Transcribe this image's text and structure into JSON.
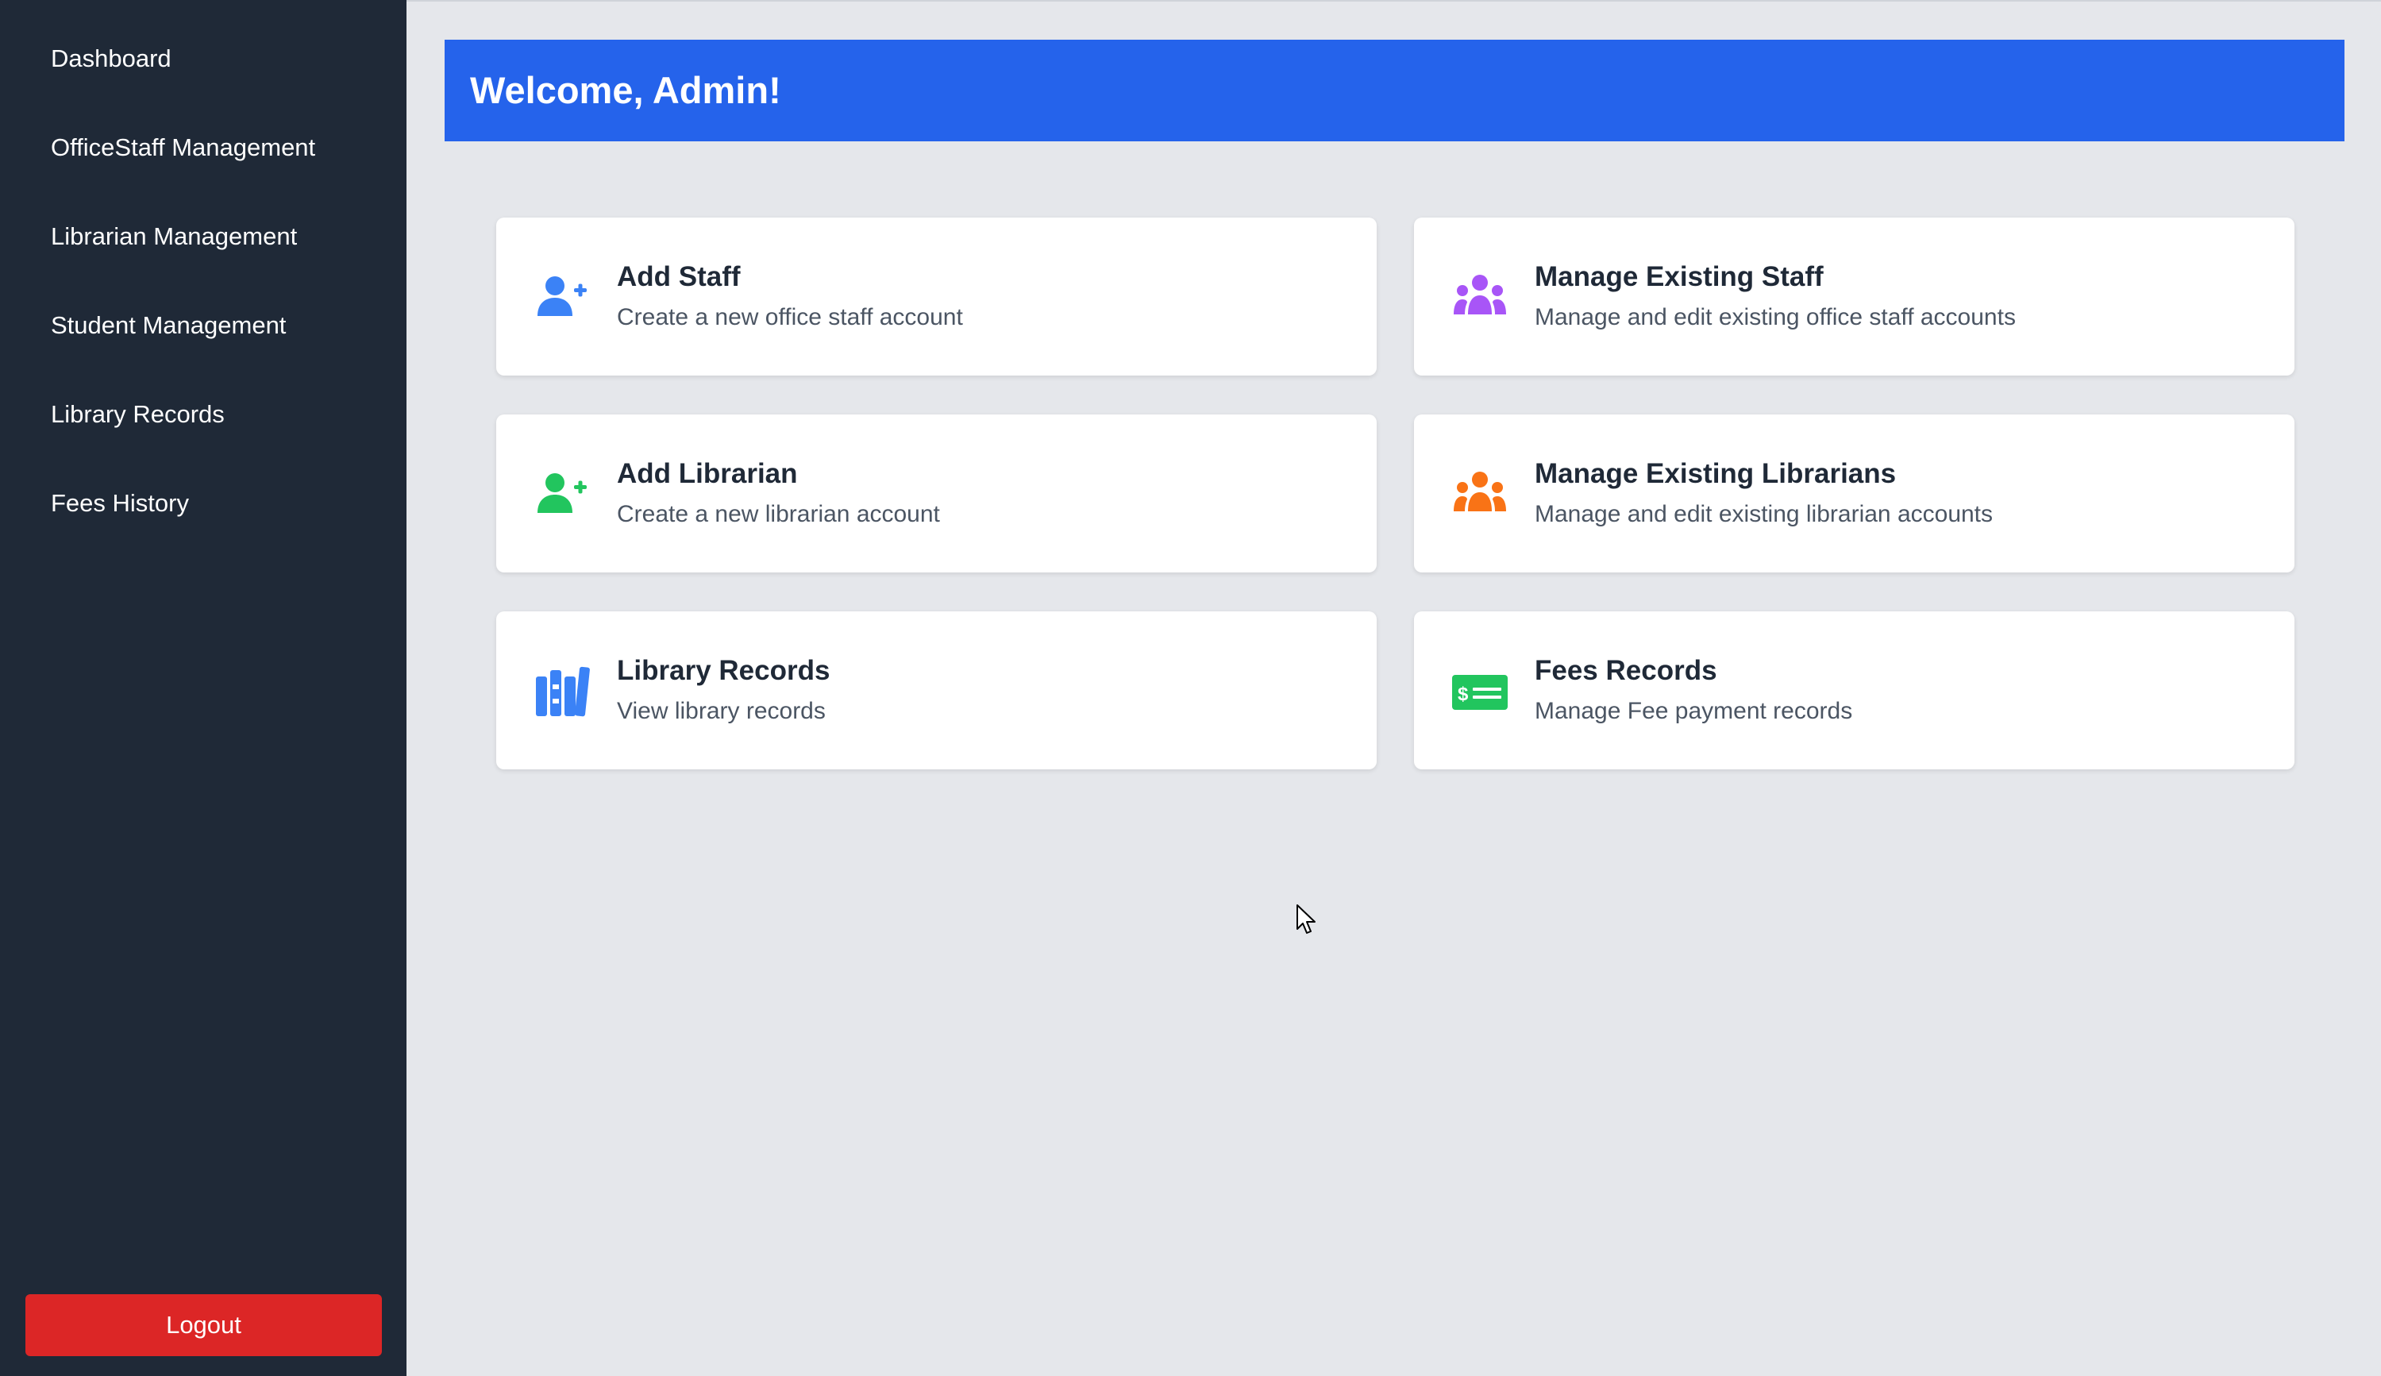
{
  "sidebar": {
    "items": [
      {
        "label": "Dashboard"
      },
      {
        "label": "OfficeStaff Management"
      },
      {
        "label": "Librarian Management"
      },
      {
        "label": "Student Management"
      },
      {
        "label": "Library Records"
      },
      {
        "label": "Fees History"
      }
    ],
    "logout_label": "Logout"
  },
  "header": {
    "title": "Welcome, Admin!"
  },
  "cards": [
    {
      "title": "Add Staff",
      "description": "Create a new office staff account",
      "icon": "user-plus-icon",
      "color": "#3b82f6"
    },
    {
      "title": "Manage Existing Staff",
      "description": "Manage and edit existing office staff accounts",
      "icon": "users-icon",
      "color": "#a855f7"
    },
    {
      "title": "Add Librarian",
      "description": "Create a new librarian account",
      "icon": "user-plus-icon",
      "color": "#22c55e"
    },
    {
      "title": "Manage Existing Librarians",
      "description": "Manage and edit existing librarian accounts",
      "icon": "users-icon",
      "color": "#f97316"
    },
    {
      "title": "Library Records",
      "description": "View library records",
      "icon": "books-icon",
      "color": "#3b82f6"
    },
    {
      "title": "Fees Records",
      "description": "Manage Fee payment records",
      "icon": "money-bill-icon",
      "color": "#22c55e"
    }
  ],
  "colors": {
    "sidebar_bg": "#1f2937",
    "main_bg": "#e5e7eb",
    "header_bg": "#2563eb",
    "logout_bg": "#dc2626"
  }
}
